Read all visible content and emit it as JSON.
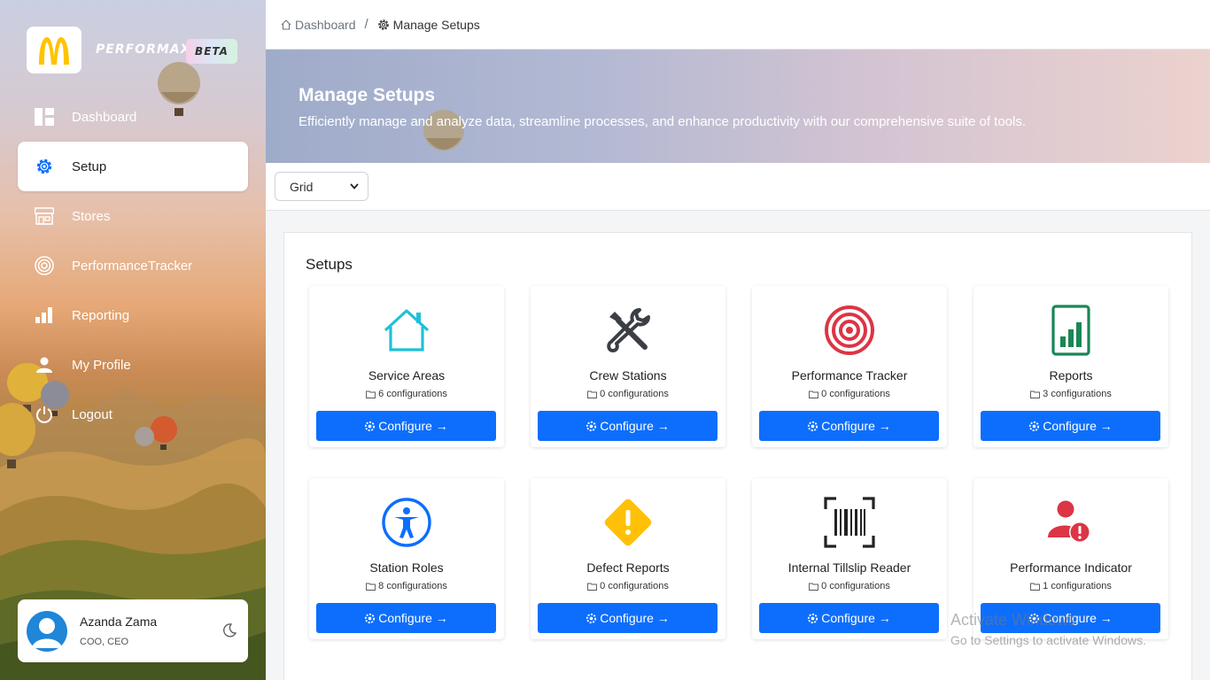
{
  "app": {
    "brand": "PERFORMAX",
    "badge": "BETA"
  },
  "sidebar": {
    "items": [
      {
        "label": "Dashboard",
        "icon": "dashboard-icon",
        "active": false
      },
      {
        "label": "Setup",
        "icon": "gear-icon",
        "active": true
      },
      {
        "label": "Stores",
        "icon": "store-icon",
        "active": false
      },
      {
        "label": "PerformanceTracker",
        "icon": "target-icon",
        "active": false
      },
      {
        "label": "Reporting",
        "icon": "bar-chart-icon",
        "active": false
      },
      {
        "label": "My Profile",
        "icon": "person-icon",
        "active": false
      },
      {
        "label": "Logout",
        "icon": "power-icon",
        "active": false
      }
    ],
    "user": {
      "name": "Azanda Zama",
      "role": "COO, CEO"
    }
  },
  "breadcrumb": {
    "home": "Dashboard",
    "separator": "/",
    "current": "Manage Setups"
  },
  "banner": {
    "title": "Manage Setups",
    "subtitle": "Efficiently manage and analyze data, streamline processes, and enhance productivity with our comprehensive suite of tools."
  },
  "toolbar": {
    "view_select": "Grid"
  },
  "setups": {
    "title": "Setups",
    "button_label": "Configure →",
    "cards": [
      {
        "title": "Service Areas",
        "count": "6 configurations",
        "icon": "house-icon",
        "color": "#1fc0d9"
      },
      {
        "title": "Crew Stations",
        "count": "0 configurations",
        "icon": "tools-icon",
        "color": "#3b3f44"
      },
      {
        "title": "Performance Tracker",
        "count": "0 configurations",
        "icon": "target-icon",
        "color": "#dc3545"
      },
      {
        "title": "Reports",
        "count": "3 configurations",
        "icon": "report-chart-icon",
        "color": "#198754"
      },
      {
        "title": "Station Roles",
        "count": "8 configurations",
        "icon": "accessibility-icon",
        "color": "#0d6efd"
      },
      {
        "title": "Defect Reports",
        "count": "0 configurations",
        "icon": "warning-icon",
        "color": "#ffc107"
      },
      {
        "title": "Internal Tillslip Reader",
        "count": "0 configurations",
        "icon": "barcode-icon",
        "color": "#222222"
      },
      {
        "title": "Performance Indicator",
        "count": "1 configurations",
        "icon": "person-alert-icon",
        "color": "#dc3545"
      }
    ]
  },
  "watermark": {
    "line1": "Activate Windows",
    "line2": "Go to Settings to activate Windows."
  }
}
